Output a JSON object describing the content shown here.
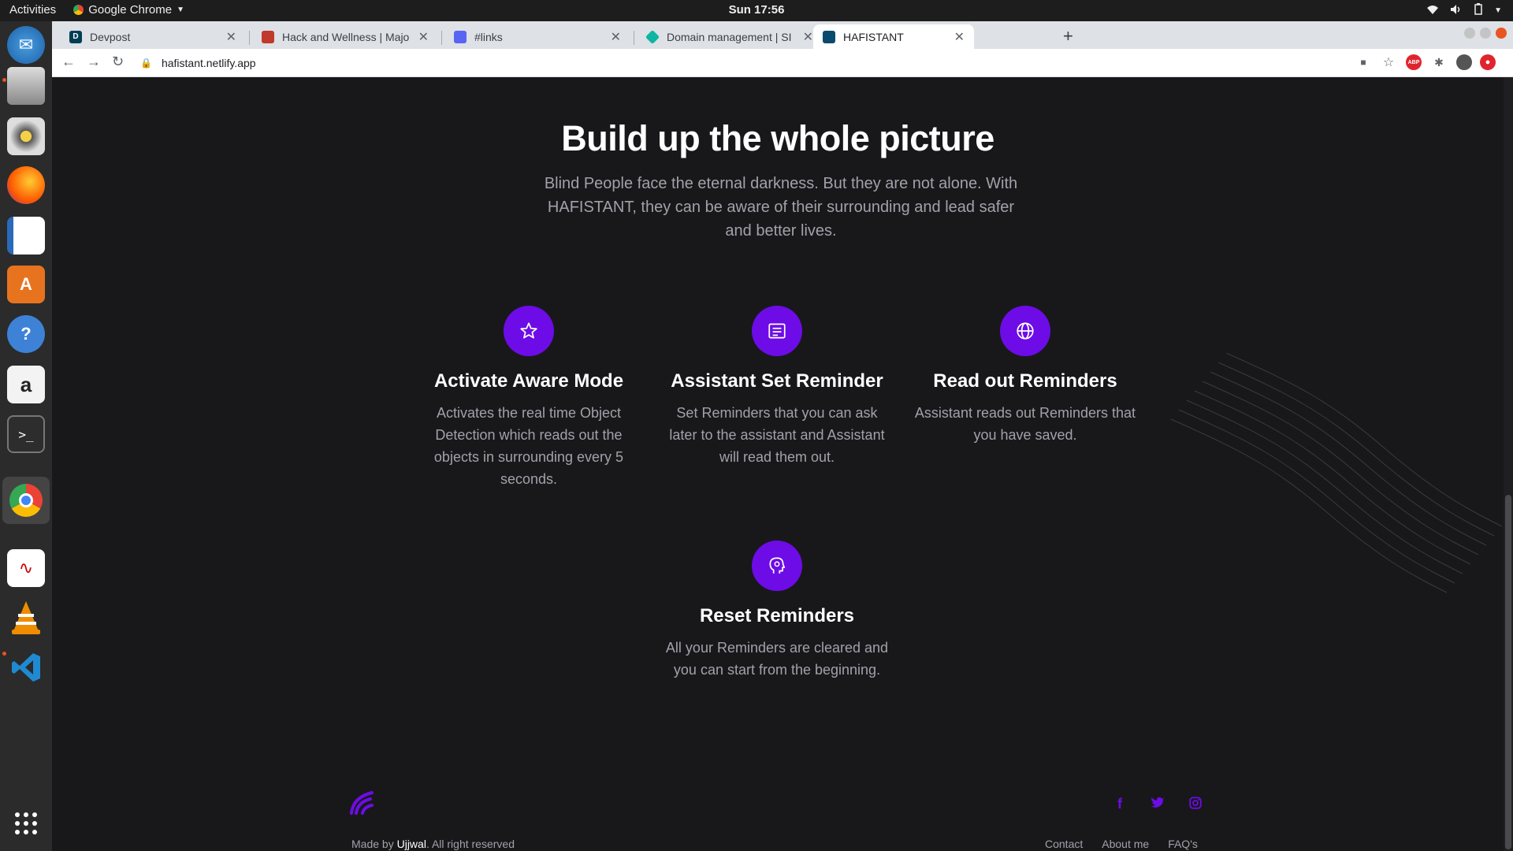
{
  "topbar": {
    "activities": "Activities",
    "app_name": "Google Chrome",
    "clock": "Sun 17:56"
  },
  "dock": {
    "items": [
      "thunderbird-icon",
      "files-icon",
      "rhythmbox-icon",
      "firefox-icon",
      "writer-icon",
      "software-icon",
      "help-icon",
      "amazon-icon",
      "terminal-icon",
      "chrome-icon",
      "evince-icon",
      "vlc-icon",
      "vscode-icon",
      "app-grid-icon"
    ]
  },
  "tabs": [
    {
      "title": "Devpost",
      "favicon_letter": "D",
      "favicon_color": "#003e54"
    },
    {
      "title": "Hack and Wellness | Majo",
      "favicon_letter": "",
      "favicon_color": "#c0392b"
    },
    {
      "title": "#links",
      "favicon_letter": "",
      "favicon_color": "#5865f2"
    },
    {
      "title": "Domain management | SI",
      "favicon_letter": "",
      "favicon_color": "#0fb5a3"
    },
    {
      "title": "HAFISTANT",
      "favicon_letter": "",
      "favicon_color": "#0b4a6f"
    }
  ],
  "toolbar": {
    "url": "hafistant.netlify.app",
    "abp_label": "ABP"
  },
  "page": {
    "title": "Build up the whole picture",
    "subtitle": "Blind People face the eternal darkness. But they are not alone. With HAFISTANT, they can be aware of their surrounding and lead safer and better lives.",
    "features": [
      {
        "title": "Activate Aware Mode",
        "description": "Activates the real time Object Detection which reads out the objects in surrounding every 5 seconds.",
        "icon": "star-icon"
      },
      {
        "title": "Assistant Set Reminder",
        "description": "Set Reminders that you can ask later to the assistant and Assistant will read them out.",
        "icon": "note-icon"
      },
      {
        "title": "Read out Reminders",
        "description": "Assistant reads out Reminders that you have saved.",
        "icon": "globe-icon"
      },
      {
        "title": "Reset Reminders",
        "description": "All your Reminders are cleared and you can start from the beginning.",
        "icon": "head-icon"
      }
    ],
    "accent_color": "#6d0ce6"
  },
  "footer": {
    "made_by": "Made by ",
    "author": "Ujjwal",
    "rights": ". All right reserved",
    "links": [
      "Contact",
      "About me",
      "FAQ's"
    ],
    "social": [
      "f",
      "t",
      "ig"
    ]
  }
}
